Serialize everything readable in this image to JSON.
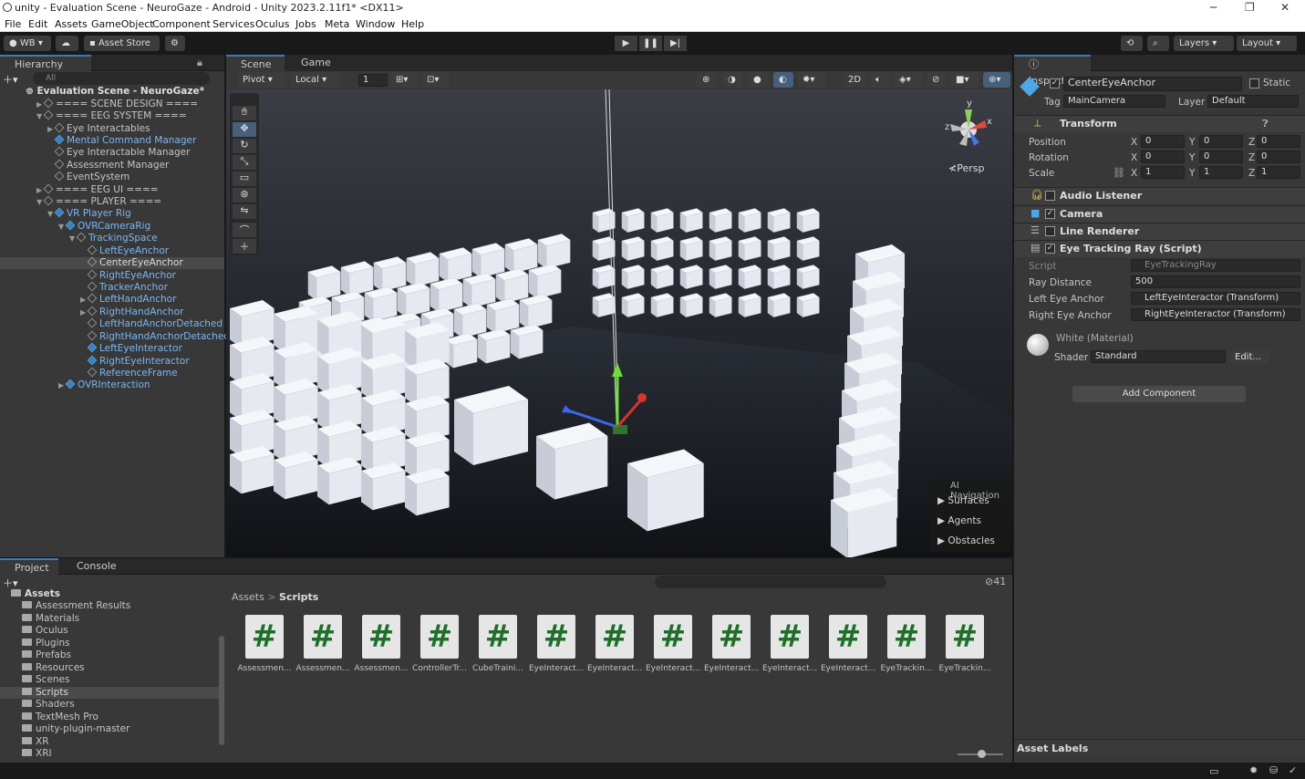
{
  "window": {
    "title": "unity - Evaluation Scene - NeuroGaze - Android - Unity 2023.2.11f1* <DX11>"
  },
  "menu": [
    "File",
    "Edit",
    "Assets",
    "GameObject",
    "Component",
    "Services",
    "Oculus",
    "Jobs",
    "Meta",
    "Window",
    "Help"
  ],
  "toolbar": {
    "account": "WB",
    "asset_store": "Asset Store",
    "layers": "Layers",
    "layout": "Layout"
  },
  "hierarchy": {
    "tab": "Hierarchy",
    "search_placeholder": "All",
    "items": [
      {
        "label": "Evaluation Scene - NeuroGaze*"
      },
      {
        "label": "==== SCENE DESIGN ===="
      },
      {
        "label": "==== EEG SYSTEM ===="
      },
      {
        "label": "Eye Interactables"
      },
      {
        "label": "Mental Command Manager"
      },
      {
        "label": "Eye Interactable Manager"
      },
      {
        "label": "Assessment Manager"
      },
      {
        "label": "EventSystem"
      },
      {
        "label": "==== EEG UI ===="
      },
      {
        "label": "==== PLAYER ===="
      },
      {
        "label": "VR Player Rig"
      },
      {
        "label": "OVRCameraRig"
      },
      {
        "label": "TrackingSpace"
      },
      {
        "label": "LeftEyeAnchor"
      },
      {
        "label": "CenterEyeAnchor"
      },
      {
        "label": "RightEyeAnchor"
      },
      {
        "label": "TrackerAnchor"
      },
      {
        "label": "LeftHandAnchor"
      },
      {
        "label": "RightHandAnchor"
      },
      {
        "label": "LeftHandAnchorDetached"
      },
      {
        "label": "RightHandAnchorDetached"
      },
      {
        "label": "LeftEyeInteractor"
      },
      {
        "label": "RightEyeInteractor"
      },
      {
        "label": "ReferenceFrame"
      },
      {
        "label": "OVRInteraction"
      }
    ]
  },
  "scene": {
    "tabs": [
      "Scene",
      "Game"
    ],
    "pivot": "Pivot",
    "space": "Local",
    "grid_value": "1",
    "mode_2d": "2D",
    "persp": "Persp",
    "ai_nav": {
      "title": "AI Navigation",
      "items": [
        "Surfaces",
        "Agents",
        "Obstacles"
      ]
    }
  },
  "inspector": {
    "tab": "Inspector",
    "object_name": "CenterEyeAnchor",
    "static_label": "Static",
    "tag_label": "Tag",
    "tag_value": "MainCamera",
    "layer_label": "Layer",
    "layer_value": "Default",
    "transform": {
      "title": "Transform",
      "rows": [
        {
          "label": "Position",
          "x": "0",
          "y": "0",
          "z": "0"
        },
        {
          "label": "Rotation",
          "x": "0",
          "y": "0",
          "z": "0"
        },
        {
          "label": "Scale",
          "x": "1",
          "y": "1",
          "z": "1"
        }
      ]
    },
    "components": [
      "Audio Listener",
      "Camera",
      "Line Renderer",
      "Eye Tracking Ray (Script)"
    ],
    "script": {
      "script_label": "Script",
      "script_value": "EyeTrackingRay",
      "ray_label": "Ray Distance",
      "ray_value": "500",
      "left_label": "Left Eye Anchor",
      "left_value": "LeftEyeInteractor (Transform)",
      "right_label": "Right Eye Anchor",
      "right_value": "RightEyeInteractor (Transform)"
    },
    "material": {
      "name": "White (Material)",
      "shader_label": "Shader",
      "shader_value": "Standard",
      "edit": "Edit..."
    },
    "add_component": "Add Component",
    "asset_labels": "Asset Labels"
  },
  "project": {
    "tabs": [
      "Project",
      "Console"
    ],
    "breadcrumb": [
      "Assets",
      "Scripts"
    ],
    "count": "41",
    "tree": [
      "Assets",
      "Assessment Results",
      "Materials",
      "Oculus",
      "Plugins",
      "Prefabs",
      "Resources",
      "Scenes",
      "Scripts",
      "Shaders",
      "TextMesh Pro",
      "unity-plugin-master",
      "XR",
      "XRI"
    ],
    "files": [
      "Assessmen...",
      "Assessmen...",
      "Assessmen...",
      "ControllerTr...",
      "CubeTraini...",
      "EyeInteract...",
      "EyeInteract...",
      "EyeInteract...",
      "EyeInteract...",
      "EyeInteract...",
      "EyeInteract...",
      "EyeTrackin...",
      "EyeTrackin..."
    ]
  }
}
